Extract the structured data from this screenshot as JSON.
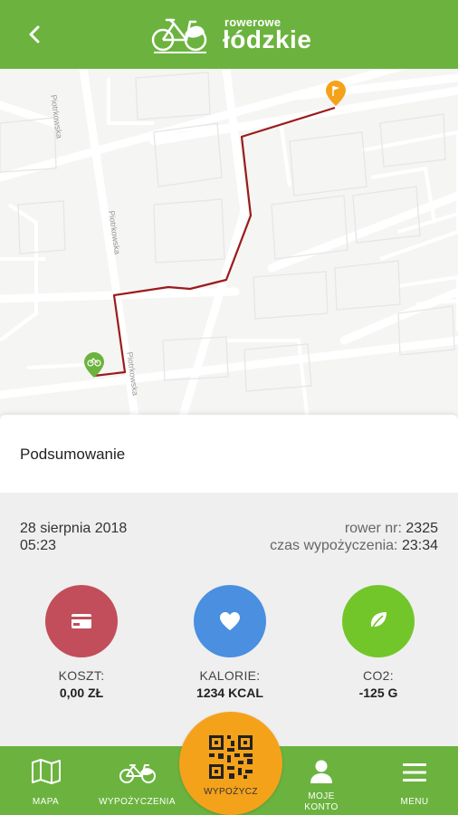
{
  "app": {
    "logo_line1": "rowerowe",
    "logo_line2": "łódzkie"
  },
  "map": {
    "street_labels": [
      "Piotrkowska",
      "Piotrkowska",
      "Piotrkowska"
    ],
    "route_color": "#9b1b1b",
    "start_marker_color": "#6bb33e",
    "end_marker_color": "#f5a21b"
  },
  "summary": {
    "title": "Podsumowanie"
  },
  "ride": {
    "date": "28 sierpnia 2018",
    "time": "05:23",
    "bike_label": "rower nr:",
    "bike_number": "2325",
    "duration_label": "czas wypożyczenia:",
    "duration": "23:34"
  },
  "stats": [
    {
      "label": "KOSZT:",
      "value": "0,00 ZŁ",
      "color": "#c14e5a",
      "icon": "card-icon"
    },
    {
      "label": "KALORIE:",
      "value": "1234 KCAL",
      "color": "#4a8fe0",
      "icon": "heart-icon"
    },
    {
      "label": "CO2:",
      "value": "-125 G",
      "color": "#72c62a",
      "icon": "leaf-icon"
    }
  ],
  "nav": {
    "map": "MAPA",
    "rentals": "WYPOŻYCZENIA",
    "rent": "WYPOŻYCZ",
    "account_line1": "MOJE",
    "account_line2": "KONTO",
    "menu": "MENU"
  }
}
